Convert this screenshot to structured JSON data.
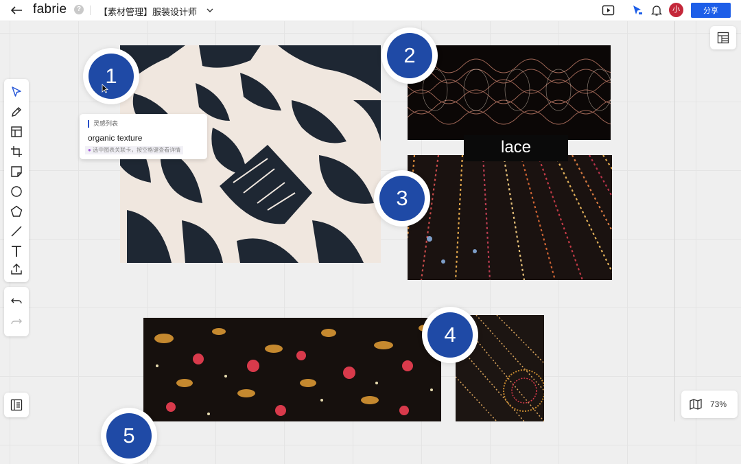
{
  "app": {
    "logo": "fabrie",
    "help": "?",
    "doc_title": "【素材管理】服装设计师",
    "avatar_text": "小",
    "share_label": "分享",
    "accent": "#1d5ee8"
  },
  "toolbar": {
    "tools": [
      "select-icon",
      "pen-icon",
      "frame-layout-icon",
      "crop-icon",
      "sticky-note-icon",
      "circle-icon",
      "pentagon-icon",
      "line-icon",
      "text-icon",
      "upload-icon"
    ],
    "history": [
      "undo-icon",
      "redo-icon"
    ]
  },
  "canvas": {
    "lace_label": "lace",
    "badges": [
      "1",
      "2",
      "3",
      "4",
      "5"
    ],
    "badge_color": "#1f4aa6"
  },
  "card": {
    "heading": "灵感列表",
    "title": "organic texture",
    "hint": "选中图表关联卡，按空格键查看详情"
  },
  "zoom": {
    "value": "73%"
  }
}
